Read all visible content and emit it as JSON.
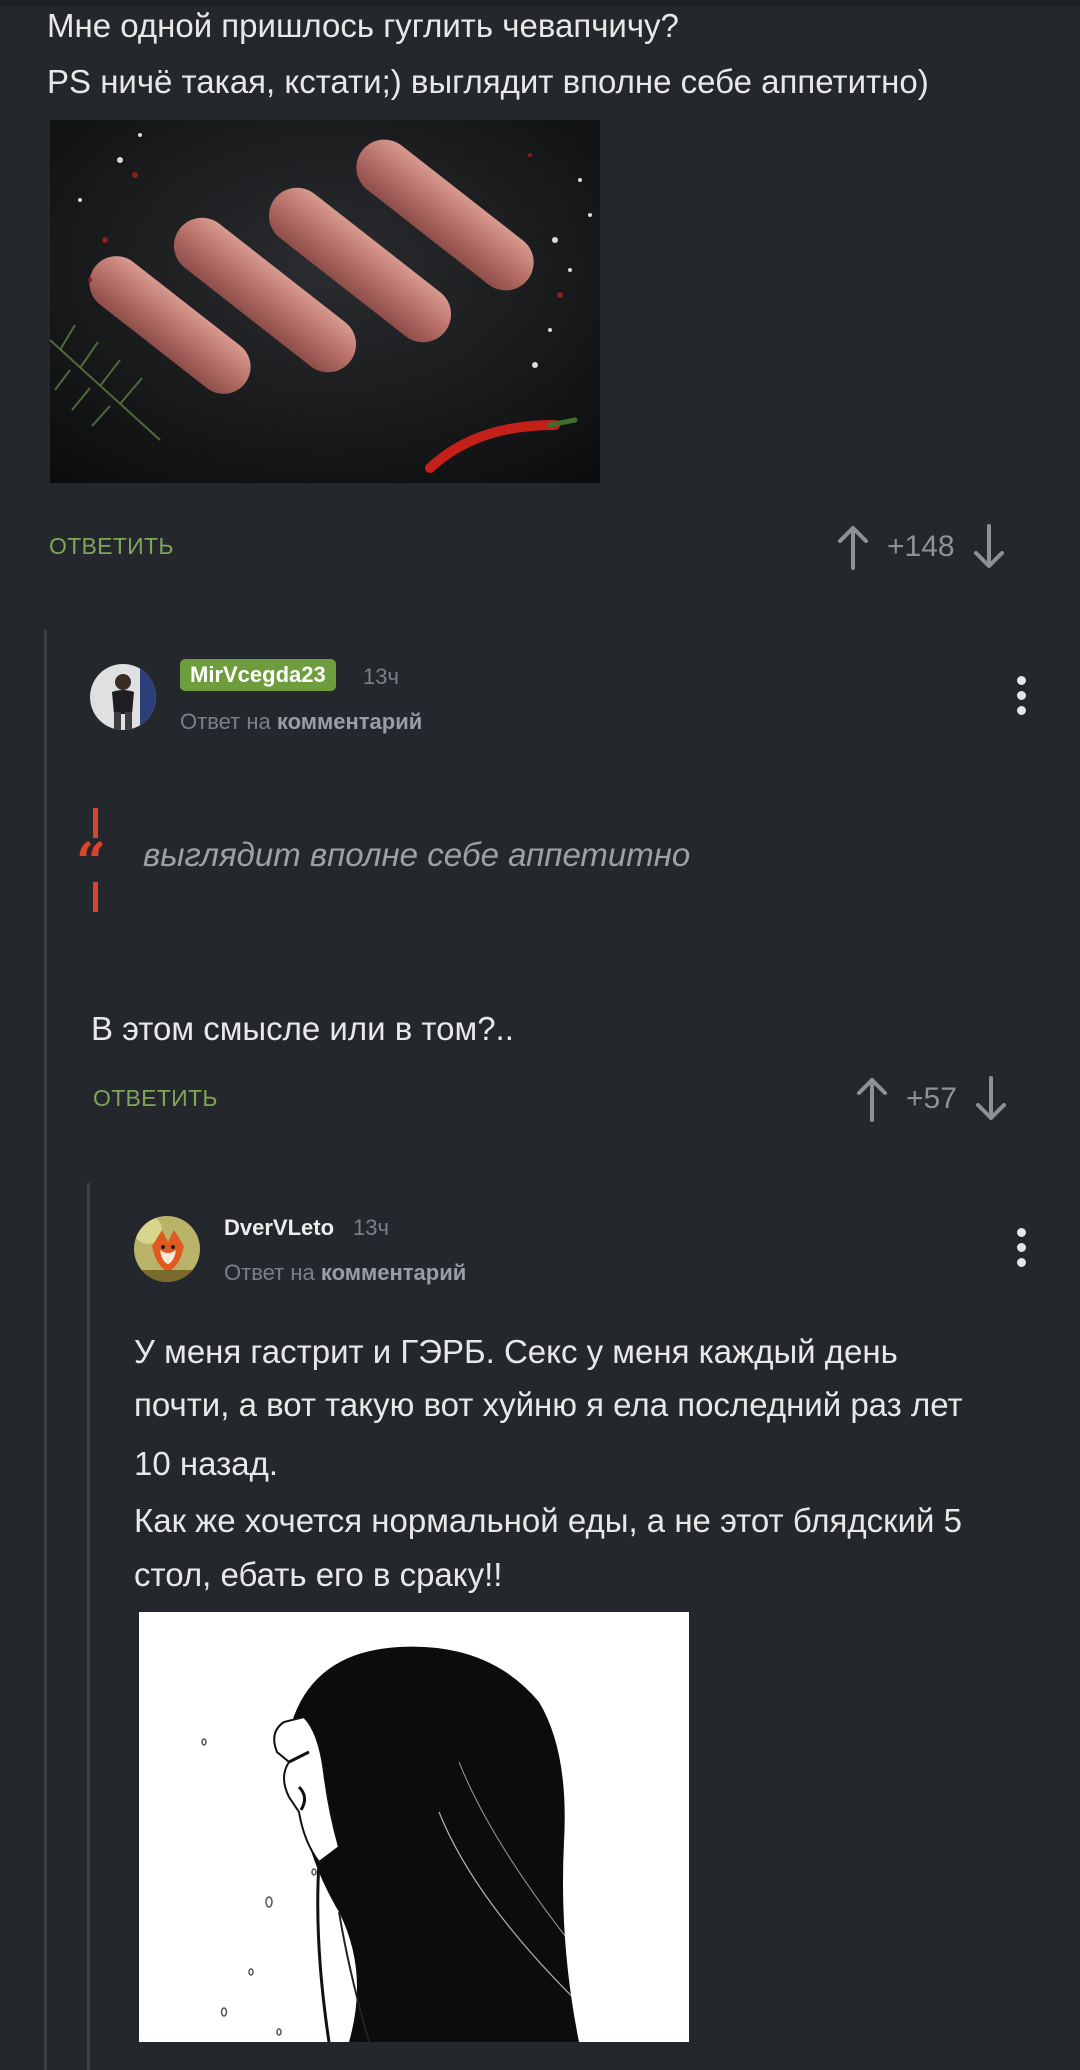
{
  "comment1": {
    "lines": [
      "Мне одной пришлось гуглить чевапчичу?",
      "PS ничё такая, кстати;) выглядит вполне себе аппетитно)"
    ],
    "reply_label": "ОТВЕТИТЬ",
    "score": "+148"
  },
  "comment2": {
    "username": "MirVcegda23",
    "time": "13ч",
    "reply_to_prefix": "Ответ на",
    "reply_to_link": "комментарий",
    "quote": "выглядит вполне себе аппетитно",
    "body": "В этом смысле или в том?..",
    "reply_label": "ОТВЕТИТЬ",
    "score": "+57"
  },
  "comment3": {
    "username": "DverVLeto",
    "time": "13ч",
    "reply_to_prefix": "Ответ на",
    "reply_to_link": "комментарий",
    "lines": [
      "У меня гастрит и ГЭРБ. Секс у меня каждый день",
      "почти, а вот такую вот хуйню я ела последний раз лет",
      "10 назад.",
      "Как же хочется нормальной еды, а не этот блядский 5",
      "стол, ебать его в сраку!!"
    ]
  },
  "colors": {
    "background": "#24272b",
    "reply_green": "#7fa55a",
    "badge_green": "#6e9d3e",
    "quote_red": "#d9452f"
  },
  "icons": [
    "arrow-up-icon",
    "arrow-down-icon",
    "more-vertical-icon",
    "quote-icon"
  ]
}
